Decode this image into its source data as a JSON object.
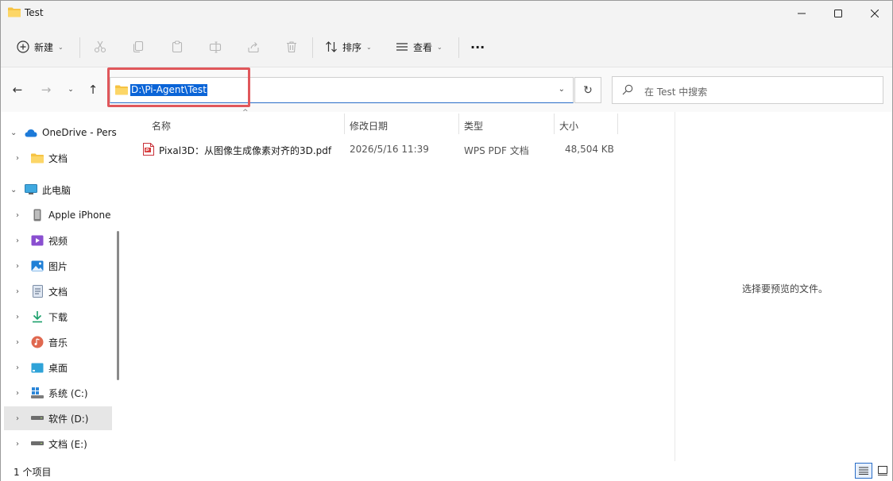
{
  "window": {
    "title": "Test",
    "minimize_icon": "minimize-icon",
    "maximize_icon": "maximize-icon",
    "close_icon": "close-icon"
  },
  "commandbar": {
    "new_label": "新建",
    "sort_label": "排序",
    "view_label": "查看",
    "more_label": "···"
  },
  "address": {
    "path": "D:\\Pi-Agent\\Test",
    "search_placeholder": "在 Test 中搜索",
    "highlight_color": "#e0575b"
  },
  "sidebar": {
    "items": [
      {
        "label": "OneDrive - Pers",
        "icon": "cloud-icon",
        "expanded": true
      },
      {
        "label": "文档",
        "icon": "folder-icon"
      },
      {
        "label": "此电脑",
        "icon": "computer-icon",
        "expanded": true
      },
      {
        "label": "Apple iPhone",
        "icon": "phone-icon"
      },
      {
        "label": "视频",
        "icon": "video-icon"
      },
      {
        "label": "图片",
        "icon": "pictures-icon"
      },
      {
        "label": "文档",
        "icon": "documents-icon"
      },
      {
        "label": "下载",
        "icon": "download-icon"
      },
      {
        "label": "音乐",
        "icon": "music-icon"
      },
      {
        "label": "桌面",
        "icon": "desktop-icon"
      },
      {
        "label": "系统 (C:)",
        "icon": "windows-drive-icon"
      },
      {
        "label": "软件 (D:)",
        "icon": "drive-icon",
        "selected": true
      },
      {
        "label": "文档 (E:)",
        "icon": "drive-icon"
      }
    ]
  },
  "filelist": {
    "columns": [
      "名称",
      "修改日期",
      "类型",
      "大小"
    ],
    "rows": [
      {
        "name": "Pixal3D：从图像生成像素对齐的3D.pdf",
        "modified": "2026/5/16 11:39",
        "type": "WPS PDF 文档",
        "size": "48,504 KB",
        "icon": "pdf-icon"
      }
    ]
  },
  "preview": {
    "message": "选择要预览的文件。"
  },
  "status": {
    "item_count": "1 个项目"
  }
}
